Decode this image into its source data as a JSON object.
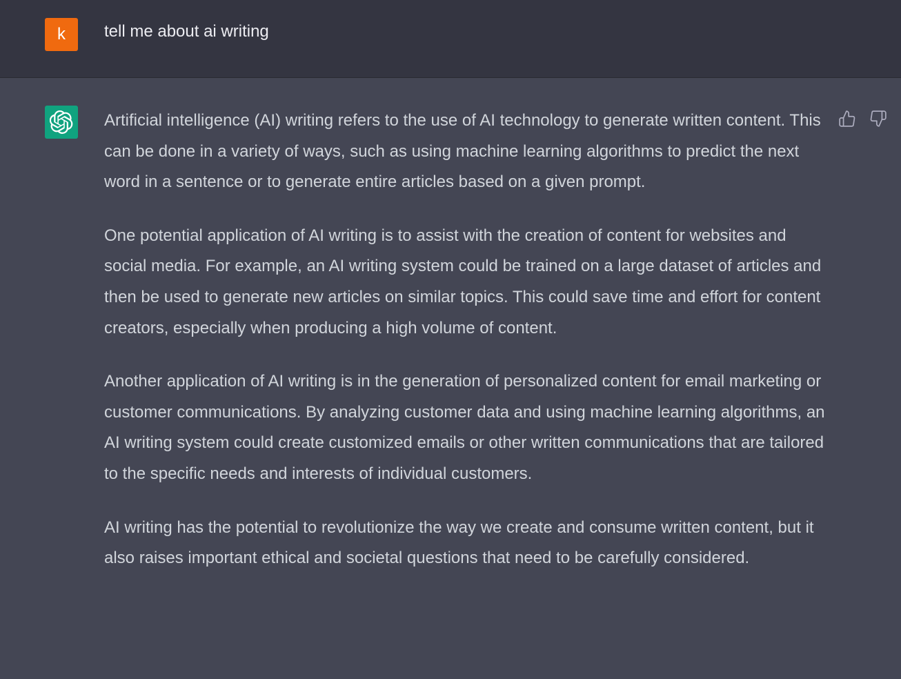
{
  "user_message": {
    "avatar_letter": "k",
    "avatar_color": "#f06a0f",
    "text": "tell me about ai writing"
  },
  "assistant_message": {
    "avatar_icon": "openai-logo-icon",
    "avatar_color": "#10a37f",
    "paragraphs": [
      "Artificial intelligence (AI) writing refers to the use of AI technology to generate written content. This can be done in a variety of ways, such as using machine learning algorithms to predict the next word in a sentence or to generate entire articles based on a given prompt.",
      "One potential application of AI writing is to assist with the creation of content for websites and social media. For example, an AI writing system could be trained on a large dataset of articles and then be used to generate new articles on similar topics. This could save time and effort for content creators, especially when producing a high volume of content.",
      "Another application of AI writing is in the generation of personalized content for email marketing or customer communications. By analyzing customer data and using machine learning algorithms, an AI writing system could create customized emails or other written communications that are tailored to the specific needs and interests of individual customers.",
      "AI writing has the potential to revolutionize the way we create and consume written content, but it also raises important ethical and societal questions that need to be carefully considered."
    ],
    "feedback": {
      "like_icon": "thumbs-up-icon",
      "dislike_icon": "thumbs-down-icon"
    }
  },
  "colors": {
    "user_row_bg": "#343541",
    "assistant_row_bg": "#444654",
    "user_text": "#ececf1",
    "assistant_text": "#d1d5db",
    "icon_color": "#acacbe"
  }
}
